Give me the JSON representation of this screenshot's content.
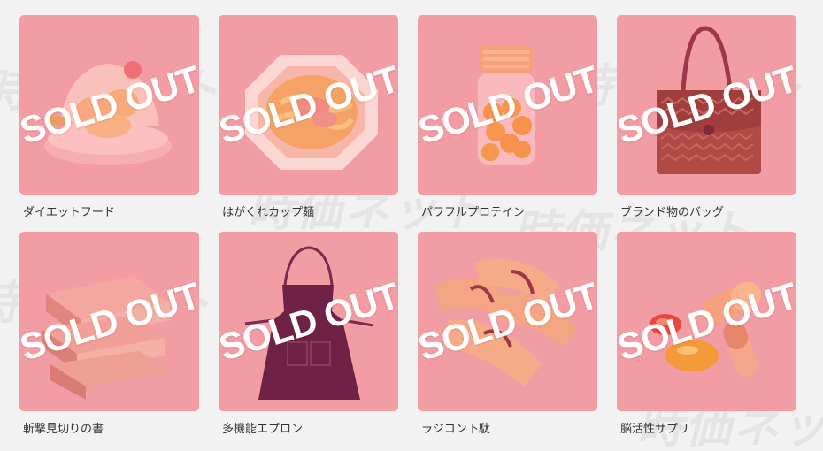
{
  "colors": {
    "page_background": "#f2f2f2",
    "thumb_overlay": "#f29ca4",
    "sold_out_text": "#ffffff",
    "name_text": "#333333"
  },
  "sold_out_label": "SOLD OUT",
  "products": [
    {
      "name": "ダイエットフード",
      "icon": "diet-food-jelly-icon"
    },
    {
      "name": "はがくれカップ麺",
      "icon": "cup-noodle-icon"
    },
    {
      "name": "パワフルプロテイン",
      "icon": "protein-bottle-icon"
    },
    {
      "name": "ブランド物のバッグ",
      "icon": "brand-bag-icon"
    },
    {
      "name": "斬撃見切りの書",
      "icon": "book-stack-icon"
    },
    {
      "name": "多機能エプロン",
      "icon": "apron-icon"
    },
    {
      "name": "ラジコン下駄",
      "icon": "geta-sandals-icon"
    },
    {
      "name": "脳活性サプリ",
      "icon": "supplement-capsules-icon"
    }
  ]
}
